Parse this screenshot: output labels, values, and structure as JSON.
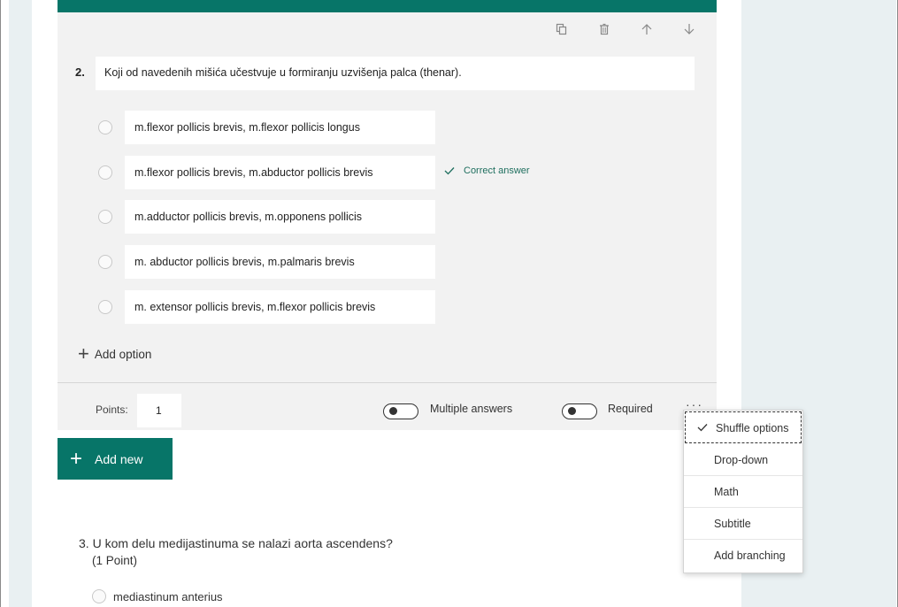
{
  "question2": {
    "number": "2.",
    "title": "Koji od navedenih mišića učestvuje u formiranju uzvišenja palca (thenar).",
    "options": [
      "m.flexor pollicis brevis, m.flexor pollicis longus",
      "m.flexor pollicis brevis, m.abductor pollicis brevis",
      "m.adductor pollicis brevis, m.opponens pollicis",
      "m. abductor pollicis brevis, m.palmaris brevis",
      "m. extensor pollicis brevis, m.flexor pollicis brevis"
    ],
    "correct_label": "Correct answer",
    "add_option": "Add option",
    "points_label": "Points:",
    "points_value": "1",
    "multiple_answers_label": "Multiple answers",
    "required_label": "Required",
    "more_label": "···"
  },
  "toolbar_icons": [
    "copy-icon",
    "trash-icon",
    "arrow-up-icon",
    "arrow-down-icon"
  ],
  "add_new_label": "Add new",
  "question3": {
    "title": "3. U kom delu medijastinuma se  nalazi aorta ascendens?",
    "points": "(1 Point)",
    "option1": "mediastinum anterius"
  },
  "menu": {
    "items": [
      "Shuffle options",
      "Drop-down",
      "Math",
      "Subtitle",
      "Add branching"
    ],
    "checked": "Shuffle options"
  },
  "colors": {
    "accent": "#077568",
    "card_bg": "#f2f2f2",
    "canvas_bg": "#e9f0f2"
  }
}
